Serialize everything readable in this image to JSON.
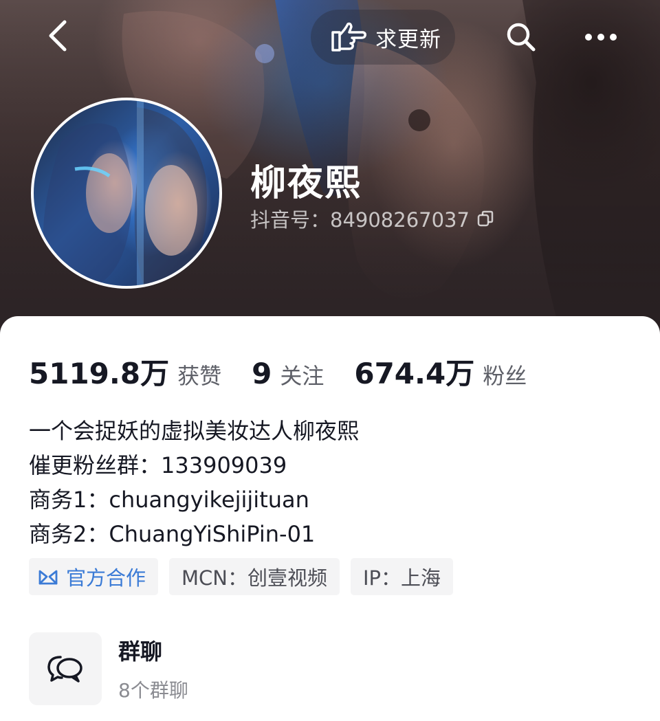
{
  "header": {
    "back_icon": "chevron-left-icon",
    "request_update_label": "求更新",
    "request_update_icon": "pointing-hand-icon",
    "search_icon": "search-icon",
    "more_icon": "more-dots-icon"
  },
  "profile": {
    "name": "柳夜熙",
    "douyin_id": "抖音号：84908267037",
    "copy_icon": "copy-icon"
  },
  "stats": {
    "likes_value": "5119.8万",
    "likes_label": "获赞",
    "following_value": "9",
    "following_label": "关注",
    "followers_value": "674.4万",
    "followers_label": "粉丝"
  },
  "bio": {
    "lines": [
      "一个会捉妖的虚拟美妆达人柳夜熙",
      "催更粉丝群：133909039",
      "商务1：chuangyikejijituan",
      "商务2：ChuangYiShiPin-01"
    ]
  },
  "tags": {
    "official": "官方合作",
    "mcn": "MCN：创壹视频",
    "ip": "IP：上海"
  },
  "group_chat": {
    "title": "群聊",
    "subtitle": "8个群聊",
    "icon": "chat-bubbles-icon"
  },
  "colors": {
    "accent_blue": "#3b7bd6",
    "text_primary": "#161823",
    "text_secondary": "#5e6068"
  }
}
